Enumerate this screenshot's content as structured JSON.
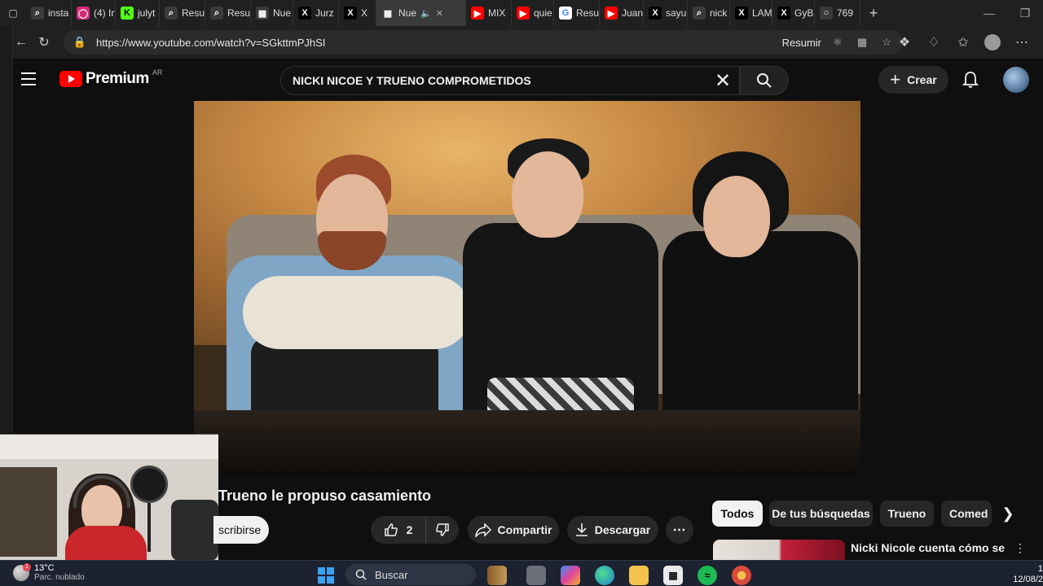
{
  "browser": {
    "tabs": [
      {
        "label": "insta",
        "icon": "search-icon",
        "color": "#3a3a3a"
      },
      {
        "label": "(4) In",
        "icon": "instagram-icon",
        "color": "#d62976"
      },
      {
        "label": "julyt",
        "icon": "kick-icon",
        "color": "#53fc18"
      },
      {
        "label": "Resu",
        "icon": "search-icon",
        "color": "#3a3a3a"
      },
      {
        "label": "Resu",
        "icon": "search-icon",
        "color": "#3a3a3a"
      },
      {
        "label": "Nue",
        "icon": "newtab-icon",
        "color": "#3a3a3a"
      },
      {
        "label": "Jurz",
        "icon": "x-icon",
        "color": "#000000"
      },
      {
        "label": "X",
        "icon": "x-icon",
        "color": "#000000"
      },
      {
        "label": "Nue",
        "icon": "newtab-icon",
        "color": "#3a3a3a"
      },
      {
        "label": "MIX",
        "icon": "youtube-icon",
        "color": "#ff0000"
      },
      {
        "label": "quie",
        "icon": "youtube-icon",
        "color": "#ff0000"
      },
      {
        "label": "Resu",
        "icon": "google-icon",
        "color": "#ffffff"
      },
      {
        "label": "Juan",
        "icon": "youtube-icon",
        "color": "#ff0000"
      },
      {
        "label": "sayu",
        "icon": "x-icon",
        "color": "#000000"
      },
      {
        "label": "nick",
        "icon": "search-icon",
        "color": "#3a3a3a"
      },
      {
        "label": "LAM",
        "icon": "x-icon",
        "color": "#000000"
      },
      {
        "label": "GyBl",
        "icon": "x-icon",
        "color": "#000000"
      },
      {
        "label": "769",
        "icon": "globe-icon",
        "color": "#3a3a3a"
      }
    ],
    "new_tab": "+",
    "url": "https://www.youtube.com/watch?v=SGkttmPJhSI",
    "summarize_label": "Resumir"
  },
  "youtube": {
    "logo_text": "Premium",
    "region": "AR",
    "search_value": "NICKI NICOE Y TRUENO COMPROMETIDOS",
    "create_label": "Crear",
    "video_title": "Trueno le propuso casamiento",
    "subscribe_label": "scribirse",
    "like_count": "2",
    "share_label": "Compartir",
    "download_label": "Descargar",
    "more_label": "⋯",
    "chips": [
      "Todos",
      "De tus búsquedas",
      "Trueno",
      "Comed"
    ],
    "related_title": "Nicki Nicole cuenta cómo se"
  },
  "taskbar": {
    "temperature": "13°C",
    "weather_desc": "Parc. nublado",
    "search_placeholder": "Buscar",
    "badge": "1",
    "time": "1",
    "date": "12/08/2"
  }
}
